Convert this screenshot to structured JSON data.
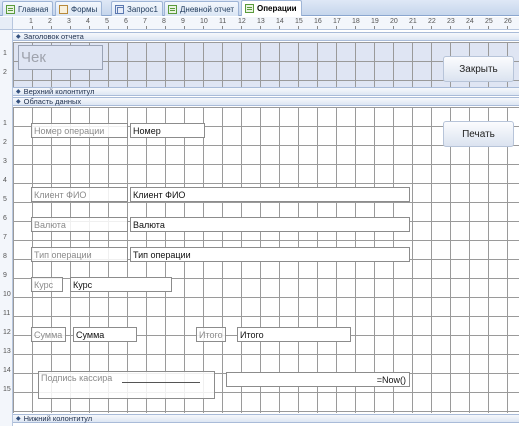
{
  "tabs": [
    {
      "label": "Главная",
      "icon": "report-icon"
    },
    {
      "label": "Формы",
      "icon": "form-icon"
    },
    {
      "label": "Запрос1",
      "icon": "query-icon"
    },
    {
      "label": "Дневной отчет",
      "icon": "report-icon"
    },
    {
      "label": "Операции",
      "icon": "report-icon",
      "active": true
    }
  ],
  "ruler": {
    "h": [
      "1",
      "2",
      "3",
      "4",
      "5",
      "6",
      "7",
      "8",
      "9",
      "10",
      "11",
      "12",
      "13",
      "14",
      "15",
      "16",
      "17",
      "18",
      "19",
      "20",
      "21",
      "22",
      "23",
      "24",
      "25",
      "26"
    ],
    "v_header": [
      "1",
      "2"
    ],
    "v_detail": [
      "1",
      "2",
      "3",
      "4",
      "5",
      "6",
      "7",
      "8",
      "9",
      "10",
      "11",
      "12",
      "13",
      "14",
      "15"
    ]
  },
  "sections": {
    "report_header": "Заголовок отчета",
    "page_header": "Верхний колонтитул",
    "detail": "Область данных",
    "page_footer": "Нижний колонтитул"
  },
  "report_header": {
    "title": "Чек",
    "close_button": "Закрыть"
  },
  "detail": {
    "print_button": "Печать",
    "fields": {
      "number_label": "Номер операции",
      "number_value": "Номер",
      "client_label": "Клиент ФИО",
      "client_value": "Клиент ФИО",
      "currency_label": "Валюта",
      "currency_value": "Валюта",
      "optype_label": "Тип операции",
      "optype_value": "Тип операции",
      "rate_label": "Курс",
      "rate_value": "Курс",
      "sum_label": "Сумма",
      "sum_value": "Сумма",
      "total_label": "Итого",
      "total_value": "Итого",
      "signature_label": "Подпись кассира",
      "date_value": "=Now()"
    }
  },
  "colors": {
    "tabbar": "#c6d6ec",
    "header_section": "#dfe5f3",
    "grid_lines": "#9a9a9a",
    "label_text": "#8b8b8b"
  }
}
